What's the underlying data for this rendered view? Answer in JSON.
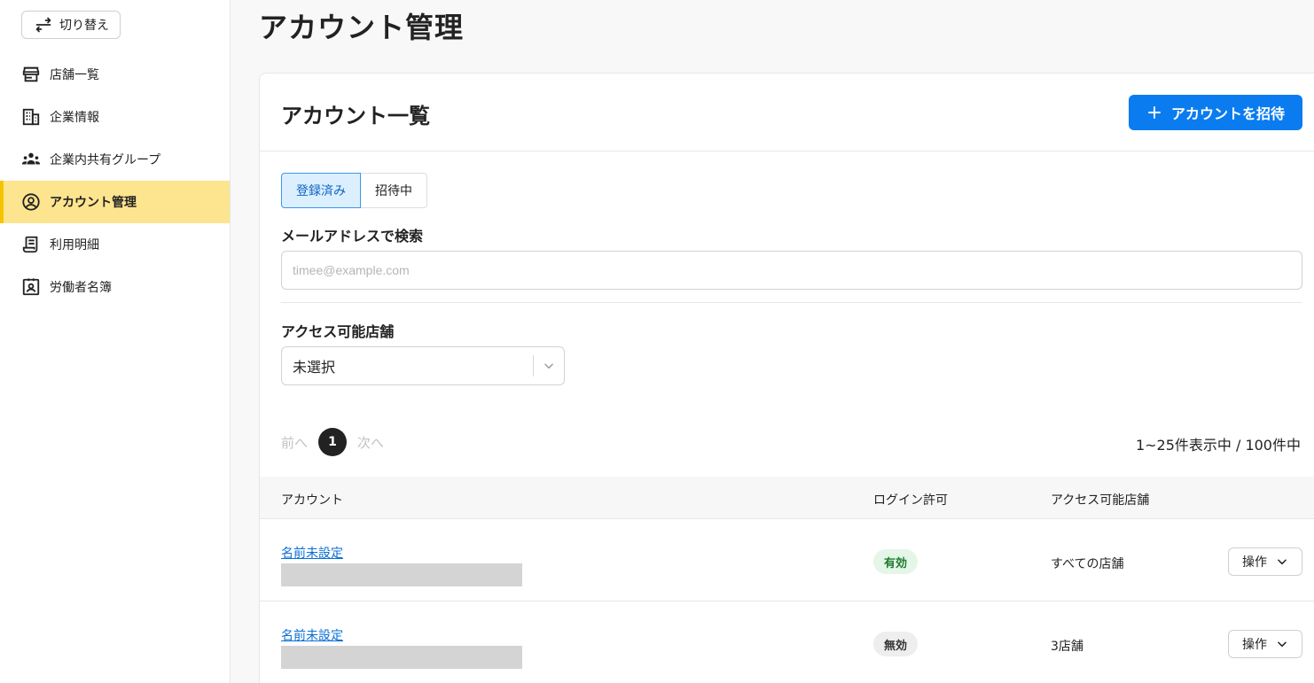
{
  "sidebar": {
    "switch_label": "切り替え",
    "items": [
      {
        "label": "店舗一覧",
        "icon": "store-icon"
      },
      {
        "label": "企業情報",
        "icon": "building-icon"
      },
      {
        "label": "企業内共有グループ",
        "icon": "group-icon"
      },
      {
        "label": "アカウント管理",
        "icon": "account-circle-icon",
        "active": true
      },
      {
        "label": "利用明細",
        "icon": "receipt-icon"
      },
      {
        "label": "労働者名簿",
        "icon": "contact-card-icon"
      }
    ]
  },
  "page": {
    "title": "アカウント管理"
  },
  "card": {
    "title": "アカウント一覧",
    "invite_label": "アカウントを招待",
    "tabs": [
      {
        "label": "登録済み",
        "selected": true
      },
      {
        "label": "招待中",
        "selected": false
      }
    ],
    "search": {
      "label": "メールアドレスで検索",
      "placeholder": "timee@example.com",
      "value": ""
    },
    "store_filter": {
      "label": "アクセス可能店舗",
      "value": "未選択"
    },
    "pager": {
      "prev": "前へ",
      "current": "1",
      "next": "次へ",
      "summary": "1~25件表示中 / 100件中"
    },
    "table": {
      "columns": [
        "アカウント",
        "ログイン許可",
        "アクセス可能店舗"
      ],
      "rows": [
        {
          "name": "名前未設定",
          "login": "有効",
          "login_state": "on",
          "stores": "すべての店舗",
          "action": "操作"
        },
        {
          "name": "名前未設定",
          "login": "無効",
          "login_state": "off",
          "stores": "3店舗",
          "action": "操作"
        }
      ]
    }
  },
  "colors": {
    "accent": "#0a7cf0",
    "active_nav": "#fde58f",
    "link": "#0a6fd6"
  }
}
